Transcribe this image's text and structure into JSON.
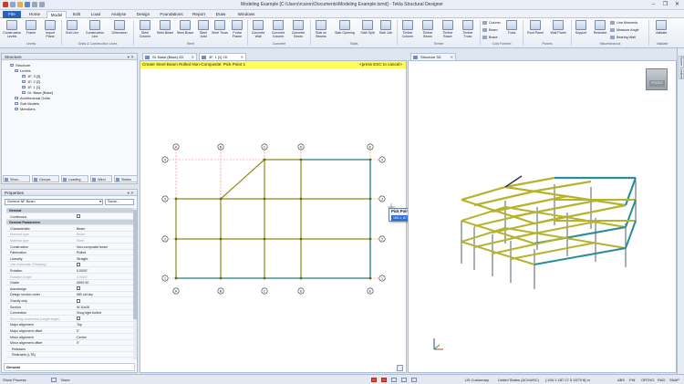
{
  "window": {
    "title": "Modeling Example [C:\\Users\\rcaron\\Documents\\Modeling Example.tsmd] - Tekla Structural Designer",
    "controls": [
      "–",
      "❐",
      "✕"
    ]
  },
  "ribbon_tabs": [
    "File",
    "Home",
    "Model",
    "Edit",
    "Load",
    "Analyse",
    "Design",
    "Foundations",
    "Report",
    "Draw",
    "Windows"
  ],
  "ribbon": {
    "buttons": [
      "Construction Levels",
      "Frame",
      "Import Plane",
      "Grid Line",
      "Construction Line",
      "Dimension",
      "Steel Column",
      "Steel Beam",
      "Steel Brace",
      "Steel Joist",
      "Steel Truss",
      "Portal Frame",
      "Concrete Wall",
      "Concrete Column",
      "Concrete Beam",
      "Slab on Beams",
      "Slab Opening",
      "Slab Split",
      "Slab Join",
      "Timber Column",
      "Timber Beam",
      "Timber Brace",
      "Timber Truss",
      "Truss",
      "Roof Panel",
      "Wall Panel",
      "Support",
      "Restraint",
      "Validate"
    ],
    "small_items": [
      "Column",
      "Beam",
      "Brace",
      "Line Moments",
      "Measure Angle",
      "Bearing Wall"
    ],
    "groups": [
      "Levels",
      "Grids & Construction Lines",
      "Steel",
      "Concrete",
      "Slabs",
      "Timber",
      "Cold Formed",
      "Panels",
      "Miscellaneous",
      "Validate"
    ]
  },
  "structure_panel": {
    "title": "Structure",
    "items": [
      "Structure",
      "Levels",
      "1F. 3 [3]",
      "1F. 2 [2]",
      "1F. 1 [1]",
      "Gr. Base [Base]",
      "Architectural Grids",
      "Sub Models",
      "Members"
    ],
    "bottom_tabs": [
      "Struc...",
      "Groups",
      "Loading",
      "Wind",
      "Status"
    ]
  },
  "properties_panel": {
    "title": "Properties",
    "selector": "General NF Beam",
    "selector2": "Same...",
    "rows": [
      {
        "k": "General",
        "v": "",
        "type": "sec"
      },
      {
        "k": "Continuous",
        "v": "chk",
        "type": ""
      },
      {
        "k": "General Parameters",
        "v": "",
        "type": "sec"
      },
      {
        "k": "Characteristic",
        "v": "Beam",
        "type": ""
      },
      {
        "k": "Element type",
        "v": "Beam",
        "type": "dis"
      },
      {
        "k": "Material type",
        "v": "Steel",
        "type": "dis"
      },
      {
        "k": "Construction",
        "v": "Non-composite beam",
        "type": ""
      },
      {
        "k": "Fabrication",
        "v": "Rolled",
        "type": ""
      },
      {
        "k": "Linearity",
        "v": "Straight",
        "type": ""
      },
      {
        "k": "Use Automatic (Shaping)",
        "v": "chk",
        "type": "dis"
      },
      {
        "k": "Rotation",
        "v": "0.0000°",
        "type": ""
      },
      {
        "k": "Rotation Angle",
        "v": "0.0000°",
        "type": "dis"
      },
      {
        "k": "Grade",
        "v": "A992 50",
        "type": ""
      },
      {
        "k": "Autodesign",
        "v": "chk",
        "type": ""
      },
      {
        "k": "Design section order",
        "v": "WB old sky",
        "type": ""
      },
      {
        "k": "Gravity only",
        "v": "chk",
        "type": ""
      },
      {
        "k": "Section",
        "v": "W 10x26",
        "type": ""
      },
      {
        "k": "Connection",
        "v": "Snug tight bolted",
        "type": ""
      },
      {
        "k": "Short leg connected (single angle)",
        "v": "chk",
        "type": "dis"
      },
      {
        "k": "Major alignment",
        "v": "Top",
        "type": ""
      },
      {
        "k": "Major alignment offset",
        "v": "0\"",
        "type": ""
      },
      {
        "k": "Minor alignment",
        "v": "Centre",
        "type": ""
      },
      {
        "k": "Minor alignment offset",
        "v": "0\"",
        "type": ""
      },
      {
        "k": "Releases",
        "v": "",
        "type": "sec2"
      },
      {
        "k": "Restraints (LTB)",
        "v": "",
        "type": "sec2"
      }
    ],
    "footer_label": "General"
  },
  "doc_tabs": [
    {
      "label": "St. Base (Base) 2D",
      "active": false
    },
    {
      "label": "3F. 1 [1] 2D",
      "active": true
    },
    {
      "label": "Structure 3D",
      "active": false
    }
  ],
  "command_bar": {
    "prompt": "Create Steel Beam Rolled Non-Composite: Pick Point 1",
    "hint": "<press ESC to cancel>",
    "color": "#fcfc5a"
  },
  "plan": {
    "col_labels": [
      "A",
      "B",
      "C",
      "D",
      "E"
    ],
    "row_labels": [
      "4",
      "3",
      "2",
      "1"
    ],
    "colors": {
      "yellow": "#8b8b18",
      "teal": "#1e7f8c",
      "grid": "#ff6f6f"
    }
  },
  "pick_dialog": {
    "title": "Pick Point 1",
    "value": "100.1, 87.07 10.0"
  },
  "view_cube": {
    "label": "FRONT"
  },
  "right_tab": "Scene Content",
  "status_bar": {
    "left": "Show Process",
    "filter": "None",
    "units": "US Customary",
    "code": "United States (ACI/AISC)",
    "coords": "[-100.1 187.27 5 187'5 ft] m",
    "modes": [
      "ABS",
      "FIN",
      "ORTHO",
      "RAD",
      "SNAP"
    ]
  }
}
